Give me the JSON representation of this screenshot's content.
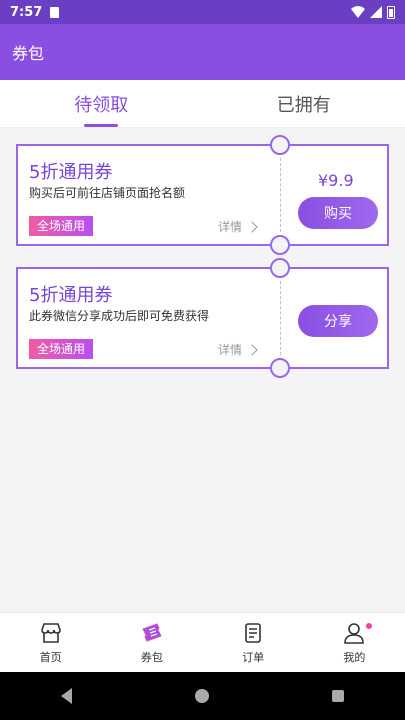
{
  "status_bar": {
    "time": "7:57"
  },
  "app_bar": {
    "title": "券包"
  },
  "tabs": [
    {
      "label": "待领取",
      "active": true
    },
    {
      "label": "已拥有",
      "active": false
    }
  ],
  "coupons": [
    {
      "name": "5折通用券",
      "description": "购买后可前往店铺页面抢名额",
      "tag": "全场通用",
      "details": "详情",
      "price": "¥9.9",
      "action": "购买"
    },
    {
      "name": "5折通用券",
      "description": "此券微信分享成功后即可免费获得",
      "tag": "全场通用",
      "details": "详情",
      "action": "分享"
    }
  ],
  "bottom_nav": [
    {
      "label": "首页",
      "icon": "shop-icon"
    },
    {
      "label": "券包",
      "icon": "ticket-icon"
    },
    {
      "label": "订单",
      "icon": "order-icon"
    },
    {
      "label": "我的",
      "icon": "user-icon"
    }
  ],
  "colors": {
    "primary": "#8a4fe0",
    "status_bar": "#6a3fc4",
    "tag_gradient_start": "#f25ba4",
    "tag_gradient_end": "#b84ff0"
  }
}
